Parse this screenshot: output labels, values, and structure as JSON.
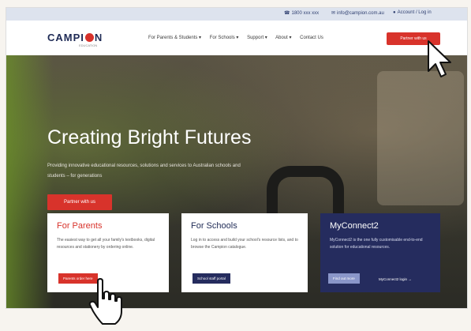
{
  "topbar": {
    "items": [
      {
        "icon": "phone-icon",
        "label": "1800 xxx xxx"
      },
      {
        "icon": "mail-icon",
        "label": "info@campion.com.au"
      },
      {
        "icon": "user-icon",
        "label": "Account / Log in"
      }
    ]
  },
  "nav": {
    "logo_text_a": "CAMPI",
    "logo_text_b": "N",
    "logo_sub": "EDUCATION",
    "menu": [
      "For Parents & Students ▾",
      "For Schools ▾",
      "Support ▾",
      "About ▾",
      "Contact Us"
    ],
    "cta": "Partner with us"
  },
  "hero": {
    "title": "Creating Bright Futures",
    "desc": "Providing innovative educational resources, solutions and services to Australian schools and students – for generations",
    "button": "Partner with us"
  },
  "cards": [
    {
      "title": "For Parents",
      "desc": "The easiest way to get all your family's textbooks, digital resources and stationery by ordering online.",
      "button": "Parents order here"
    },
    {
      "title": "For Schools",
      "desc": "Log in to access and build your school's resource lists, and to browse the Campion catalogue.",
      "button": "School staff portal"
    },
    {
      "title": "MyConnect2",
      "desc": "MyConnect2 is the one fully customisable end-to-end solution for educational resources.",
      "button": "Find out more",
      "link": "MyConnect2 login →"
    }
  ],
  "colors": {
    "brand_red": "#d8332b",
    "navy": "#252c5e",
    "topbar": "#dde3ee"
  }
}
